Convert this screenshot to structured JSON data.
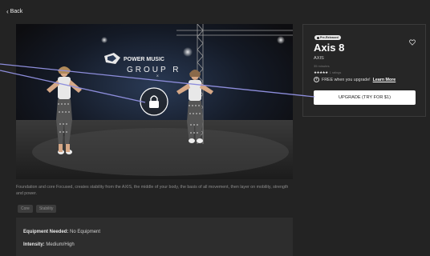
{
  "nav": {
    "back_label": "Back",
    "back_icon": "chevron-left-icon"
  },
  "video": {
    "logo_line1": "POWER MUSIC",
    "logo_line2": "GROUP R",
    "logo_sub": "X",
    "lock_icon": "lock-icon"
  },
  "description": "Foundation and core Focused, creates stability from the AXIS, the middle of your body, the basis of all movement, then layer on mobility, strength and power.",
  "tags": [
    "Core",
    "Stability"
  ],
  "details": {
    "equipment_label": "Equipment Needed:",
    "equipment_value": "No Equipment",
    "intensity_label": "Intensity:",
    "intensity_value": "Medium/High"
  },
  "panel": {
    "badge_label": "Pre-Released",
    "title": "Axis 8",
    "subtitle": "AXIS",
    "duration": "35 minutes",
    "stars": "★★★★★",
    "rating_count": "1 ratings",
    "rating": 5,
    "free_text": "FREE when you upgrade!",
    "learn_more": "Learn More",
    "upgrade_button": "UPGRADE (TRY FOR $1)"
  },
  "colors": {
    "background": "#232323",
    "panel": "#262626",
    "button": "#ffffff",
    "annotation_line": "#8e8edc"
  }
}
